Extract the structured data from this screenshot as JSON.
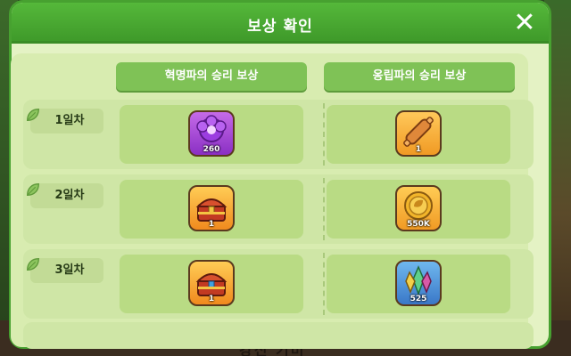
{
  "dialog": {
    "title": "보상 확인",
    "close_label": "✕"
  },
  "columns": {
    "left": "혁명파의 승리 보상",
    "right": "옹립파의 승리 보상"
  },
  "days": [
    {
      "label": "1일차",
      "left_reward": {
        "icon": "purple-gem-cluster-icon",
        "count": "260"
      },
      "right_reward": {
        "icon": "rolling-pin-icon",
        "count": "1"
      }
    },
    {
      "label": "2일차",
      "left_reward": {
        "icon": "treasure-chest-icon",
        "count": "1"
      },
      "right_reward": {
        "icon": "gold-coin-icon",
        "count": "550K"
      }
    },
    {
      "label": "3일차",
      "left_reward": {
        "icon": "treasure-chest-icon",
        "count": "1"
      },
      "right_reward": {
        "icon": "soulstone-crystal-icon",
        "count": "525"
      }
    }
  ],
  "background_text": "강신 기미",
  "colors": {
    "titlebar": "#4aa934",
    "panel": "#e4f2c4",
    "header": "#7fc256",
    "cell": "#b9db84"
  }
}
